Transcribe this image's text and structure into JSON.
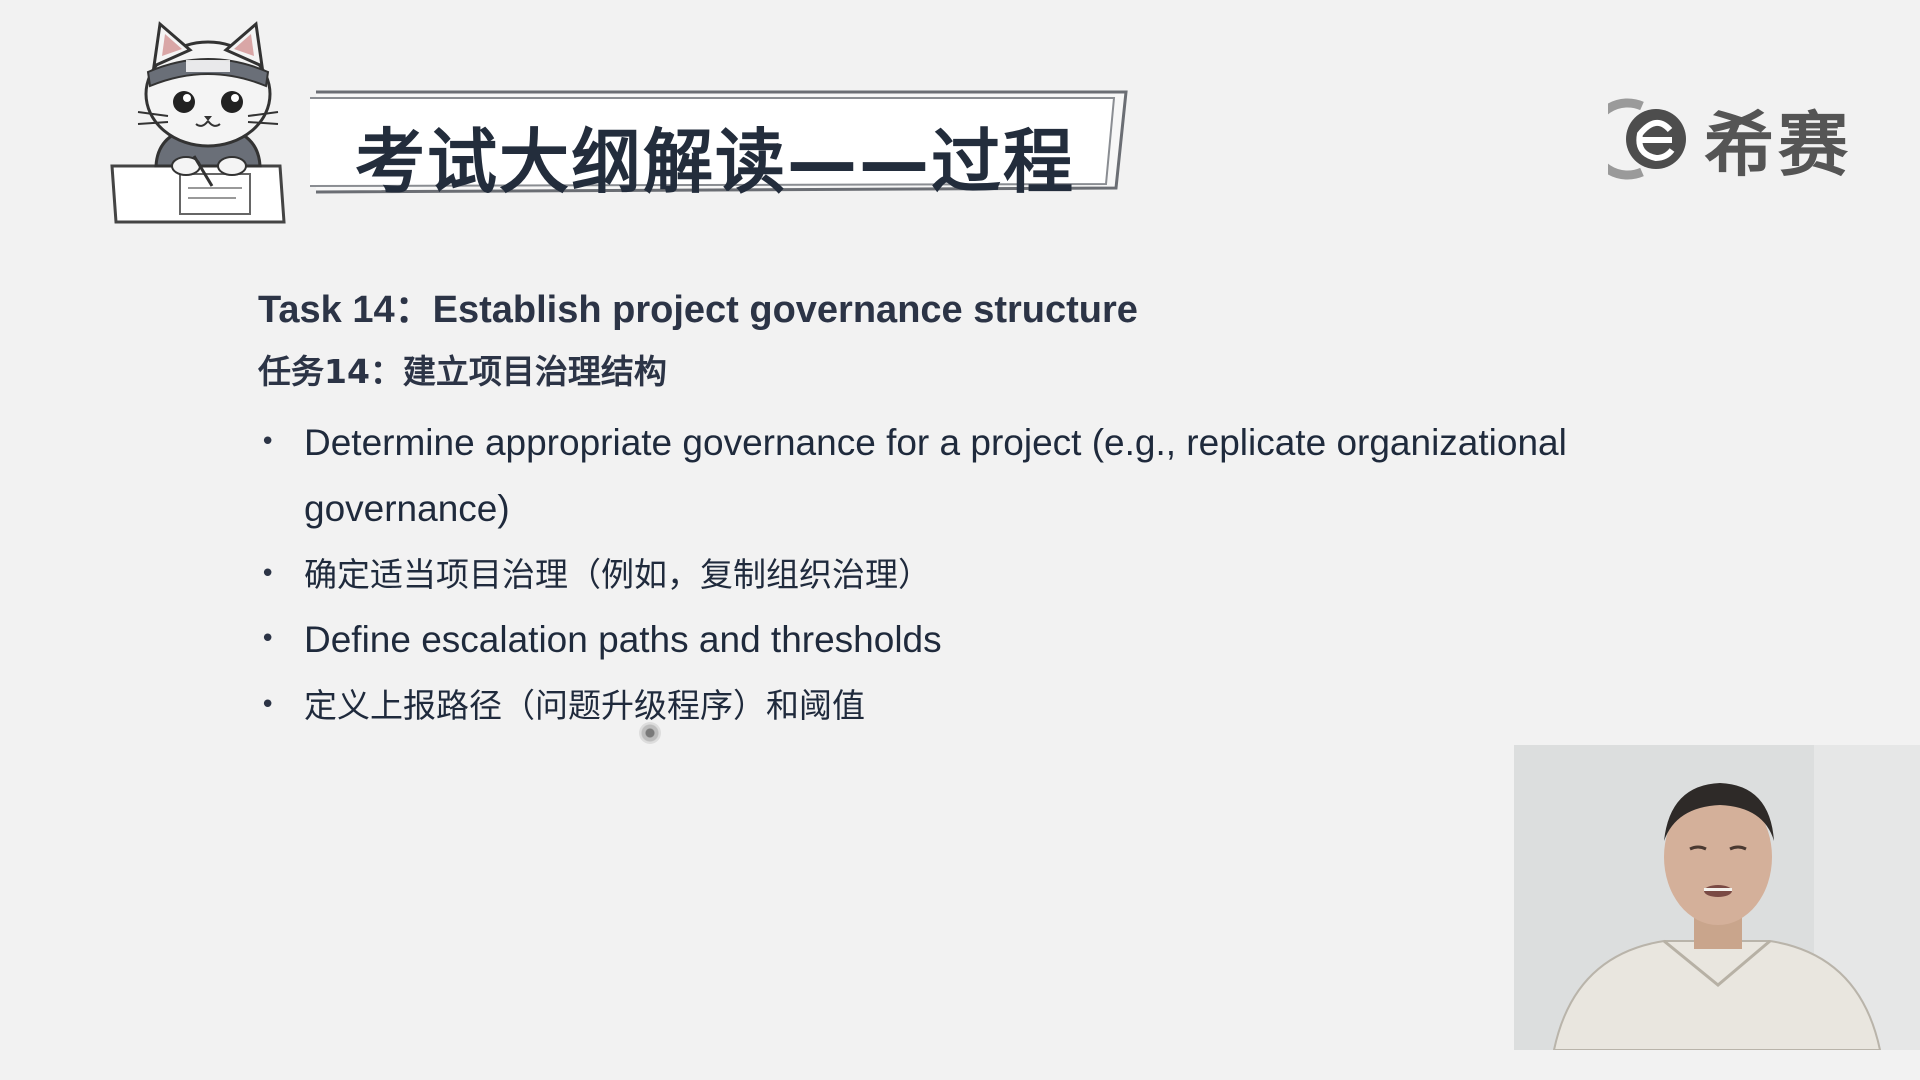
{
  "header": {
    "title": "考试大纲解读——过程"
  },
  "brand": {
    "name": "希赛",
    "mark_icon": "xisai-e-logo-icon"
  },
  "mascot": {
    "icon": "cat-mascot-writing-icon"
  },
  "content": {
    "task_title_en": "Task 14：Establish project governance structure",
    "task_title_zh": "任务14：建立项目治理结构",
    "bullets": [
      {
        "text": "Determine appropriate governance for a project (e.g., replicate organizational governance)",
        "lang": "en"
      },
      {
        "text": "确定适当项目治理（例如，复制组织治理）",
        "lang": "zh"
      },
      {
        "text": "Define escalation paths and thresholds",
        "lang": "en"
      },
      {
        "text": "定义上报路径（问题升级程序）和阈值",
        "lang": "zh"
      }
    ],
    "bullet_glyph": "•"
  },
  "webcam": {
    "icon": "presenter-video-feed"
  },
  "colors": {
    "background": "#f2f2f2",
    "title_text": "#232d3c",
    "body_text": "#1f2a3c",
    "brand_gray": "#555555"
  }
}
